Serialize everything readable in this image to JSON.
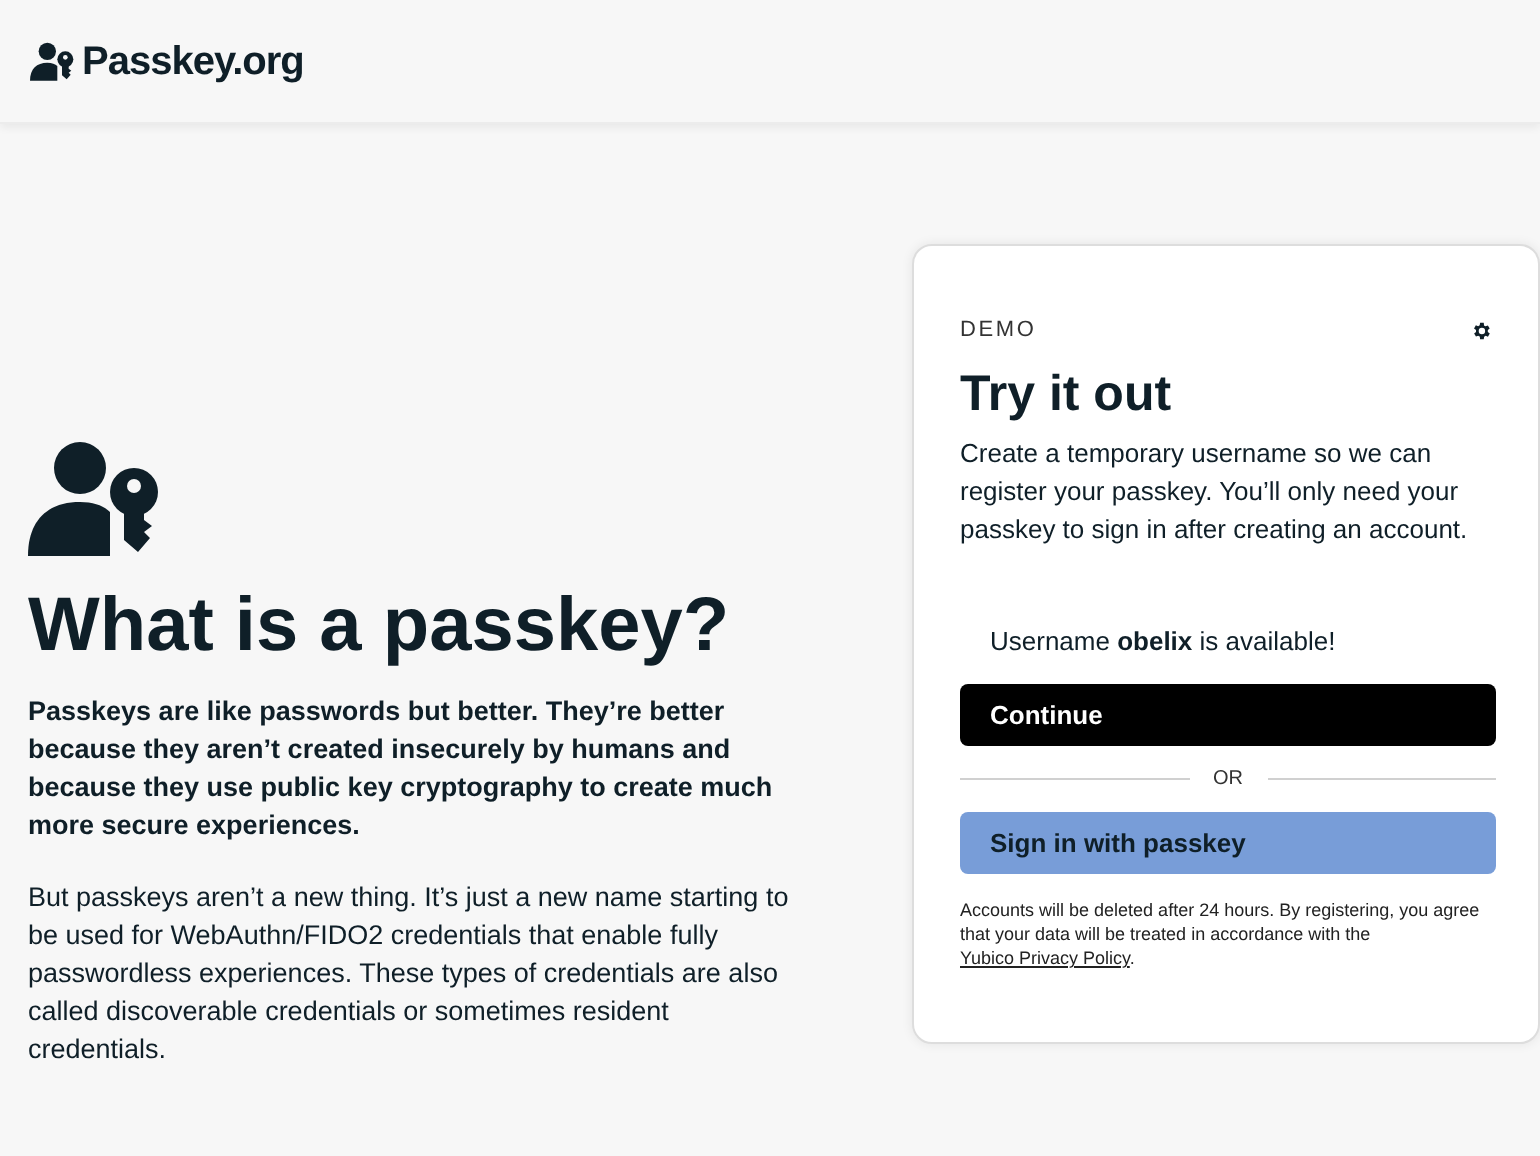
{
  "header": {
    "logo_text": "Passkey.org"
  },
  "intro": {
    "heading": "What is a passkey?",
    "lead": "Passkeys are like passwords but better. They’re better because they aren’t created insecurely by humans and because they use public key cryptography to create much more secure experiences.",
    "body": "But passkeys aren’t a new thing. It’s just a new name starting to be used for WebAuthn/FIDO2 credentials that enable fully passwordless experiences. These types of credentials are also called discoverable credentials or sometimes resident credentials."
  },
  "demo_card": {
    "eyebrow": "DEMO",
    "title": "Try it out",
    "description": "Create a temporary username so we can register your passkey. You’ll only need your passkey to sign in after creating an account.",
    "availability": "Username **obelix** is available!",
    "continue_button": "Continue",
    "divider": "OR",
    "passkey_button": "Sign in with passkey",
    "notice": "Accounts will be deleted after 24 hours. By registering, you agree that your data will be treated in accordance with the",
    "notice_link": "Yubico Privacy Policy",
    "notice_end": "."
  }
}
